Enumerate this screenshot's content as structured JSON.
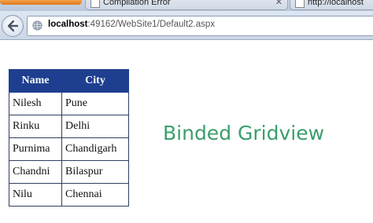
{
  "browser": {
    "tabs": [
      {
        "label": "Compilation Error",
        "active": false
      },
      {
        "label": "http://localhost",
        "active": false
      }
    ],
    "address": {
      "host": "localhost",
      "path": ":49162/WebSite1/Default2.aspx"
    },
    "icons": {
      "back": "back-arrow-icon",
      "site": "globe-icon",
      "tab_close": "close-icon"
    }
  },
  "grid": {
    "headers": {
      "name": "Name",
      "city": "City"
    },
    "header_bg": "#1e3f8f",
    "rows": [
      {
        "name": "Nilesh",
        "city": "Pune"
      },
      {
        "name": "Rinku",
        "city": "Delhi"
      },
      {
        "name": "Purnima",
        "city": "Chandigarh"
      },
      {
        "name": "Chandni",
        "city": "Bilaspur"
      },
      {
        "name": "Nilu",
        "city": "Chennai"
      }
    ]
  },
  "heading": {
    "text": "Binded Gridview",
    "color": "#3a9e6a"
  }
}
